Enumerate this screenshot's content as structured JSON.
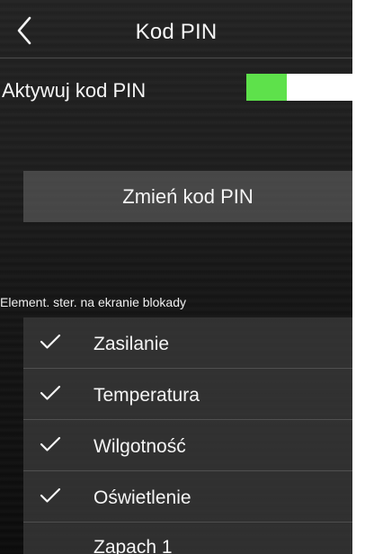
{
  "header": {
    "title": "Kod PIN",
    "back_icon": "chevron-left-icon"
  },
  "pin_settings": {
    "activate_label": "Aktywuj kod PIN",
    "toggle": {
      "state": "on",
      "level": 0.38,
      "on_color": "#5ee14b",
      "off_color": "#ffffff"
    },
    "change_button_label": "Zmień kod PIN"
  },
  "lock_screen_controls": {
    "section_label": "Element. ster. na ekranie blokady",
    "items": [
      {
        "label": "Zasilanie",
        "checked": true,
        "icon": "checkmark-icon"
      },
      {
        "label": "Temperatura",
        "checked": true,
        "icon": "checkmark-icon"
      },
      {
        "label": "Wilgotność",
        "checked": true,
        "icon": "checkmark-icon"
      },
      {
        "label": "Oświetlenie",
        "checked": true,
        "icon": "checkmark-icon"
      },
      {
        "label": "Zapach 1",
        "checked": false,
        "icon": ""
      }
    ]
  }
}
